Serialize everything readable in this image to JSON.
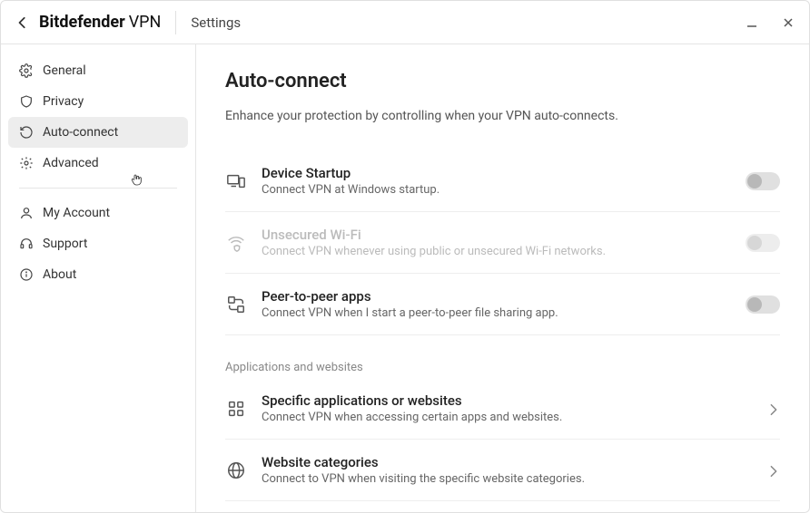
{
  "header": {
    "brand_bold": "Bitdefender",
    "brand_thin": "VPN",
    "section": "Settings"
  },
  "sidebar": {
    "items": [
      {
        "label": "General"
      },
      {
        "label": "Privacy"
      },
      {
        "label": "Auto-connect",
        "active": true
      },
      {
        "label": "Advanced"
      }
    ],
    "lower": [
      {
        "label": "My Account"
      },
      {
        "label": "Support"
      },
      {
        "label": "About"
      }
    ]
  },
  "page": {
    "title": "Auto-connect",
    "subtitle": "Enhance your protection by controlling when your VPN auto-connects.",
    "toggles": [
      {
        "title": "Device Startup",
        "desc": "Connect VPN at Windows startup."
      },
      {
        "title": "Unsecured Wi-Fi",
        "desc": "Connect VPN whenever using public or unsecured Wi-Fi networks.",
        "disabled": true
      },
      {
        "title": "Peer-to-peer apps",
        "desc": "Connect VPN when I start a peer-to-peer file sharing app."
      }
    ],
    "group_label": "Applications and websites",
    "links": [
      {
        "title": "Specific applications or websites",
        "desc": "Connect VPN when accessing certain apps and websites."
      },
      {
        "title": "Website categories",
        "desc": "Connect to VPN when visiting the specific website categories."
      }
    ]
  }
}
